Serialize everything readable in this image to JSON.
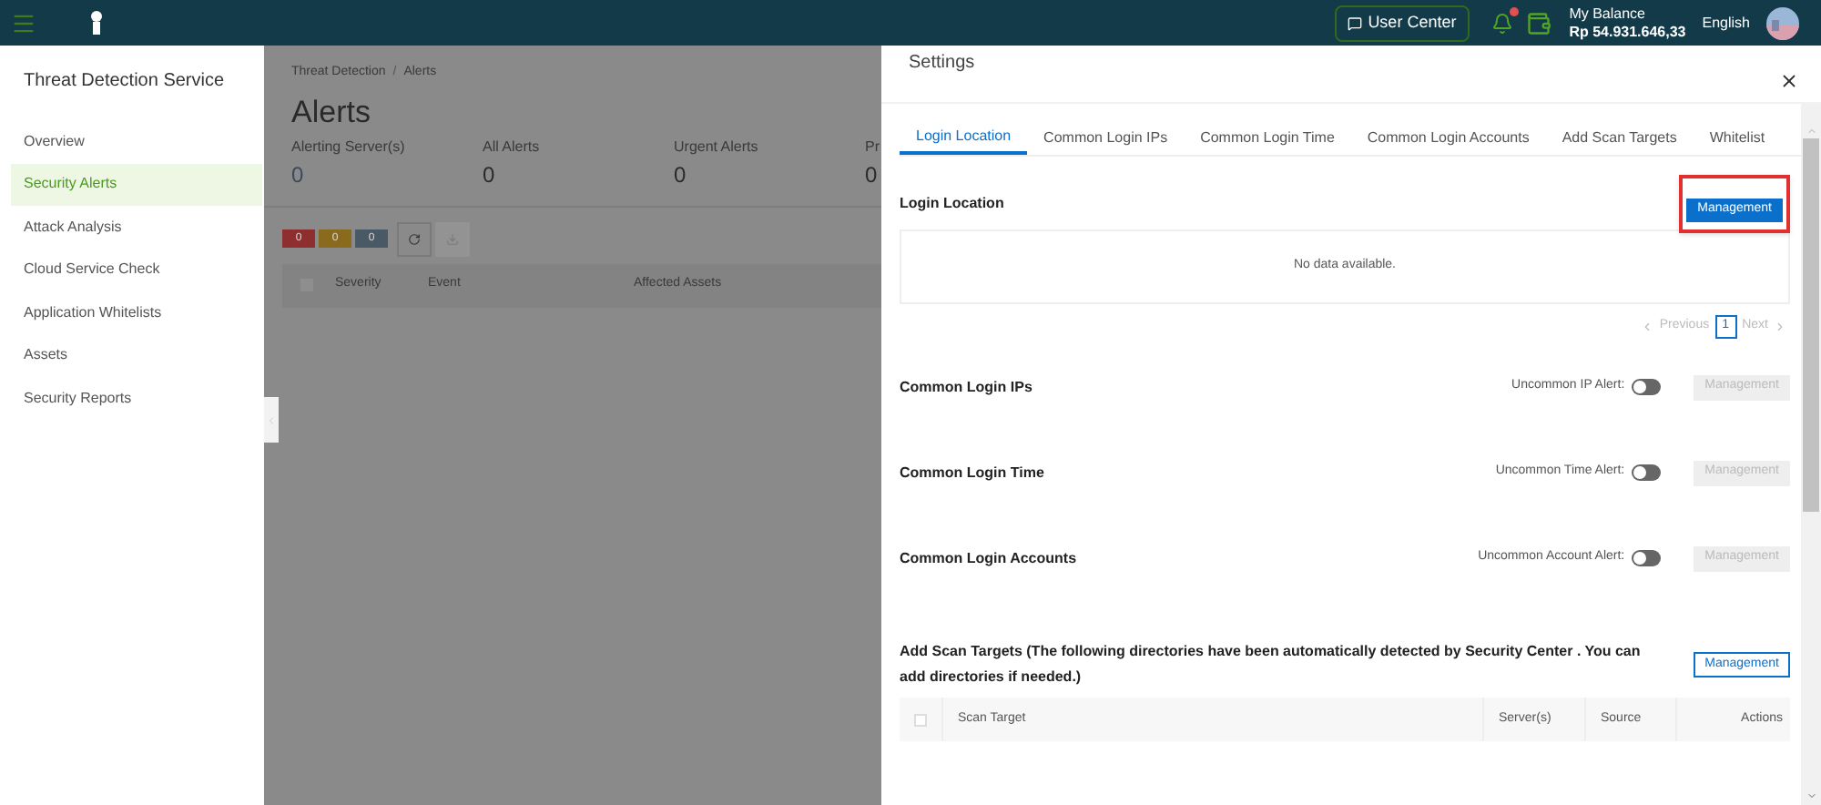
{
  "topbar": {
    "user_center": "User Center",
    "has_notification": true,
    "balance_label": "My Balance",
    "balance": "Rp 54.931.646,33",
    "language": "English"
  },
  "sidebar": {
    "title": "Threat Detection Service",
    "items": [
      {
        "label": "Overview",
        "selected": false
      },
      {
        "label": "Security Alerts",
        "selected": true
      },
      {
        "label": "Attack Analysis",
        "selected": false
      },
      {
        "label": "Cloud Service Check",
        "selected": false
      },
      {
        "label": "Application Whitelists",
        "selected": false
      },
      {
        "label": "Assets",
        "selected": false
      },
      {
        "label": "Security Reports",
        "selected": false
      }
    ]
  },
  "page": {
    "breadcrumb": [
      "Threat Detection",
      "Alerts"
    ],
    "breadcrumb_separator": "/",
    "select_all_checked": false,
    "title": "Alerts",
    "stats": [
      {
        "label": "Alerting Server(s)",
        "value": "0"
      },
      {
        "label": "All Alerts",
        "value": "0"
      },
      {
        "label": "Urgent Alerts",
        "value": "0"
      },
      {
        "label": "Pr",
        "value": "0"
      }
    ],
    "severity_counts": [
      {
        "value": "0",
        "color": "#8e2e2e"
      },
      {
        "value": "0",
        "color": "#8a6a1c"
      },
      {
        "value": "0",
        "color": "#4a5966"
      }
    ],
    "columns": [
      "Severity",
      "Event",
      "Affected Assets"
    ]
  },
  "drawer": {
    "title": "Settings",
    "tabs": [
      {
        "label": "Login Location",
        "selected": true
      },
      {
        "label": "Common Login IPs",
        "selected": false
      },
      {
        "label": "Common Login Time",
        "selected": false
      },
      {
        "label": "Common Login Accounts",
        "selected": false
      },
      {
        "label": "Add Scan Targets",
        "selected": false
      },
      {
        "label": "Whitelist",
        "selected": false
      }
    ],
    "sections": [
      {
        "kind": "table",
        "title": "Login Location",
        "button": "Management",
        "highlighted": true,
        "empty": "No data available.",
        "pagination": {
          "previous": "Previous",
          "pages": [
            {
              "label": "1",
              "selected": true
            }
          ],
          "next": "Next"
        }
      },
      {
        "kind": "toggle",
        "title": "Common Login IPs",
        "alert_label": "Uncommon IP Alert:",
        "on": false,
        "button": "Management"
      },
      {
        "kind": "toggle",
        "title": "Common Login Time",
        "alert_label": "Uncommon Time Alert:",
        "on": false,
        "button": "Management"
      },
      {
        "kind": "toggle",
        "title": "Common Login Accounts",
        "alert_label": "Uncommon Account Alert:",
        "on": false,
        "button": "Management"
      },
      {
        "kind": "scan",
        "select_all_checked": false,
        "title": "Add Scan Targets  (The following directories have been automatically detected by Security Center . You can add directories if needed.)",
        "button": "Management",
        "columns": [
          "Scan Target",
          "Server(s)",
          "Source",
          "Actions"
        ]
      }
    ]
  }
}
